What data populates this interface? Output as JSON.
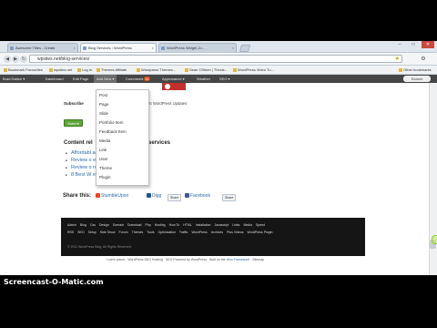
{
  "browser": {
    "tabs": [
      {
        "label": "Awesome Titles - Create"
      },
      {
        "label": "Blog Services ‹ WordPress"
      },
      {
        "label": "WordPress Widget Jo..."
      }
    ],
    "window_controls": [
      "–",
      "□",
      "✕"
    ],
    "url": "wpsites.net/blog-services/",
    "bookmarks": [
      "Bookmark Favourites",
      "wpsites.net",
      "Log In",
      "Themes Affiliate",
      "Wordpress Themes...",
      "Sean O'Brien | Thesis...",
      "WordPress Video Tu...",
      "Other bookmarks"
    ]
  },
  "admin_bar": {
    "items": [
      "Brad Dalton ▾",
      "Dashboard",
      "Edit Page",
      "Add New ▾",
      "Comments",
      "Appearance ▾",
      "Weather",
      "SEO ▾"
    ],
    "comment_count": "11",
    "search": "Search"
  },
  "add_new_menu": [
    "Post",
    "Page",
    "Slide",
    "Portfolio Item",
    "Feedback Item",
    "Media",
    "Link",
    "User",
    "Theme",
    "Plugin"
  ],
  "content": {
    "subscribe_label": "Subscribe",
    "receive_text": "ceive The Latest WordPress Updates",
    "subscribe_button": "Submit",
    "related_heading": "Content rel",
    "related_heading_tail": "services",
    "related_links": [
      "Affordabl                          ages",
      "Review o                          ess Themes",
      "Review o                          ress Web Hosts",
      "8 Best W                          ers Landing Pages"
    ],
    "share_label": "Share this:",
    "share_items": [
      "StumbleUpon",
      "Digg",
      "Share",
      "Facebook",
      "Share"
    ]
  },
  "footer": {
    "row1": [
      "Admin",
      "Blog",
      "Css",
      "Design",
      "Domain",
      "Download",
      "Php",
      "Hosting",
      "How To",
      "HTML",
      "Installation",
      "Javascript",
      "Links",
      "Media",
      "Speed"
    ],
    "row2": [
      "RSS",
      "SEO",
      "Setup",
      "Side Show",
      "Forum",
      "Themes",
      "Tools",
      "Optimization",
      "Traffic",
      "WordPress",
      "Archives",
      "Plus Videos",
      "WordPress Plugin"
    ],
    "copyright": "© 2011 WordPress Blog, All Rights Reserved.",
    "credit_text": "Lorem ipsum · WordPress SEO Hosting · SEO Powered by WordPress · Built on the ",
    "credit_link": "Woo Framework",
    "credit_end": " · Sitemap"
  },
  "watermark": "Screencast-O-Matic.com"
}
